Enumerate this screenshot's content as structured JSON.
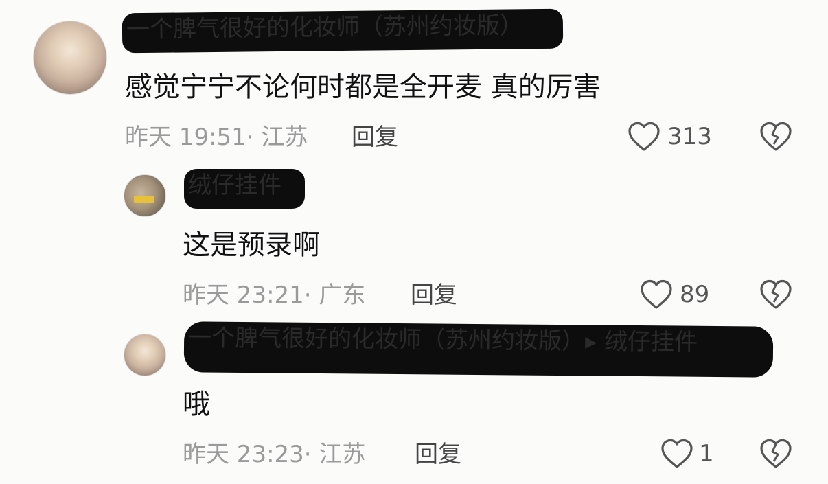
{
  "comments": [
    {
      "username": "一个脾气很好的化妆师（苏州约妆版）",
      "text": "感觉宁宁不论何时都是全开麦 真的厉害",
      "time": "昨天 19:51",
      "location": "江苏",
      "reply_label": "回复",
      "likes": "313"
    },
    {
      "username": "绒仔挂件",
      "text": "这是预录啊",
      "time": "昨天 23:21",
      "location": "广东",
      "reply_label": "回复",
      "likes": "89"
    },
    {
      "username": "一个脾气很好的化妆师（苏州约妆版）▸ 绒仔挂件",
      "text": "哦",
      "time": "昨天 23:23",
      "location": "江苏",
      "reply_label": "回复",
      "likes": "1"
    }
  ],
  "icons": {
    "like": "heart-outline-icon",
    "dislike": "broken-heart-icon"
  },
  "colors": {
    "text": "#111111",
    "meta": "#9a9a9a",
    "redaction": "#0d0d0d"
  }
}
